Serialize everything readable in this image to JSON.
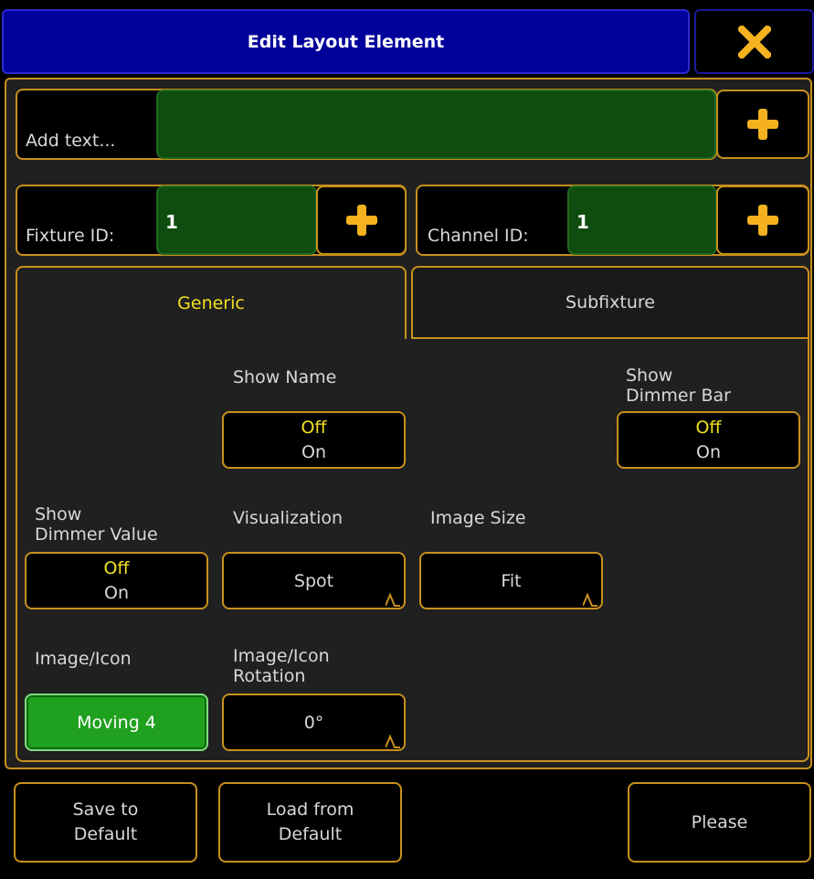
{
  "window": {
    "title": "Edit Layout Element",
    "close_icon": "close-icon"
  },
  "text_row": {
    "label": "Add text...",
    "value": ""
  },
  "fixture": {
    "label": "Fixture ID:",
    "value": "1"
  },
  "channel": {
    "label": "Channel ID:",
    "value": "1"
  },
  "tabs": [
    {
      "label": "Generic",
      "active": true
    },
    {
      "label": "Subfixture",
      "active": false
    }
  ],
  "controls": {
    "show_name": {
      "label": "Show Name",
      "off": "Off",
      "on": "On"
    },
    "show_dimmer_bar": {
      "label_line1": "Show",
      "label_line2": "Dimmer Bar",
      "off": "Off",
      "on": "On"
    },
    "show_dimmer_value": {
      "label_line1": "Show",
      "label_line2": "Dimmer Value",
      "off": "Off",
      "on": "On"
    },
    "visualization": {
      "label": "Visualization",
      "value": "Spot"
    },
    "image_size": {
      "label": "Image Size",
      "value": "Fit"
    },
    "image_icon": {
      "label": "Image/Icon",
      "value": "Moving 4"
    },
    "image_icon_rotation": {
      "label_line1": "Image/Icon",
      "label_line2": "Rotation",
      "value": "0°"
    }
  },
  "footer": {
    "save_line1": "Save to",
    "save_line2": "Default",
    "load_line1": "Load from",
    "load_line2": "Default",
    "please": "Please"
  },
  "colors": {
    "accent": "#c8901c",
    "title_bg": "#00009a",
    "active_text": "#f0e020",
    "green": "#1fa01f",
    "plus": "#f5b21e"
  }
}
